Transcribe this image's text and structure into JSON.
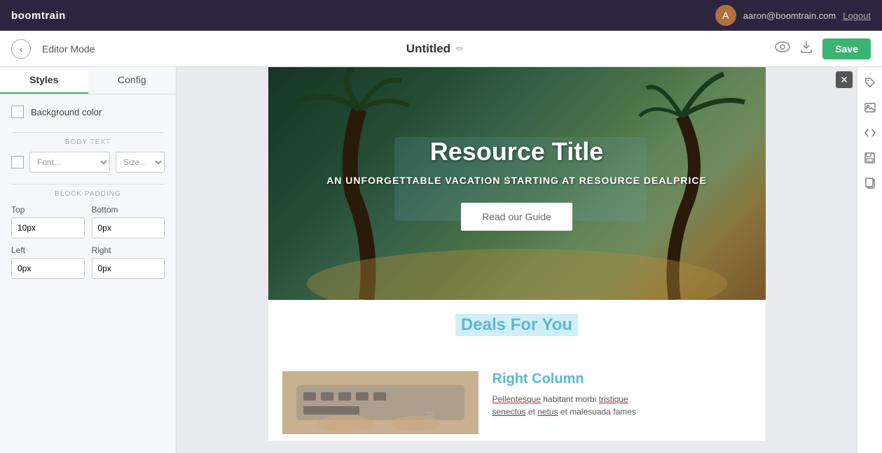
{
  "topnav": {
    "brand": "boomtrain",
    "user_email": "aaron@boomtrain.com",
    "logout_label": "Logout"
  },
  "editor_toolbar": {
    "back_label": "‹",
    "mode_label": "Editor Mode",
    "doc_title": "Untitled",
    "edit_icon": "✏",
    "preview_icon": "👁",
    "download_icon": "⬇",
    "save_label": "Save"
  },
  "sidebar": {
    "tab_styles": "Styles",
    "tab_config": "Config",
    "bg_color_label": "Background color",
    "body_text_label": "BODY TEXT",
    "font_placeholder": "Font...",
    "size_placeholder": "Size...",
    "block_padding_label": "BLOCK PADDING",
    "top_label": "Top",
    "top_value": "10px",
    "bottom_label": "Bottom",
    "bottom_value": "0px",
    "left_label": "Left",
    "left_value": "0px",
    "right_label": "Right",
    "right_value": "0px"
  },
  "email_canvas": {
    "hero": {
      "title": "Resource Title",
      "subtitle": "AN UNFORGETTABLE VACATION STARTING AT RESOURCE DEALPRICE",
      "button_label": "Read our Guide"
    },
    "deals_section": {
      "title": "Deals For You"
    },
    "two_col": {
      "right_title": "Right Column",
      "right_text": "Pellentesque habitant morbi tristique senectus et netus et malesuada fames"
    }
  },
  "right_tools": {
    "tag_icon": "🏷",
    "image_icon": "🖼",
    "code_icon": "<>",
    "save_icon": "💾",
    "copy_icon": "📋"
  }
}
